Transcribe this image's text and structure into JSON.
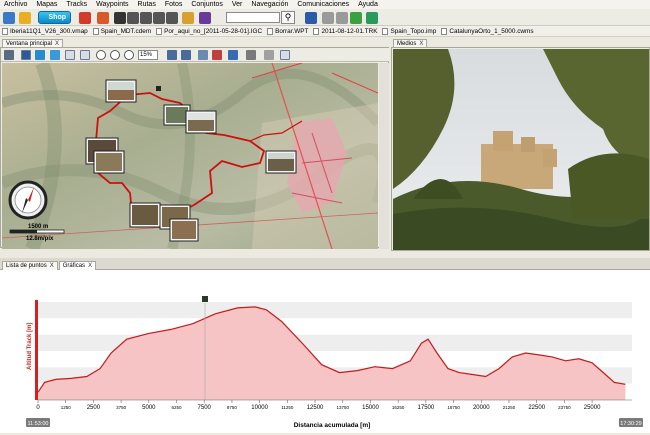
{
  "menu": [
    "Archivo",
    "Mapas",
    "Tracks",
    "Waypoints",
    "Rutas",
    "Fotos",
    "Conjuntos",
    "Ver",
    "Navegación",
    "Comunicaciones",
    "Ayuda"
  ],
  "toolbar": {
    "shop_label": "Shop",
    "search_icon": "magnifier-icon"
  },
  "files": [
    "Iberia11Q1_V26_300.vmap",
    "Spain_MDT.cdem",
    "Por_aqui_no_[2011-05-28-01].IGC",
    "Borrar.WPT",
    "2011-08-12-01.TRK",
    "Spain_Topo.imp",
    "CatalunyaOrto_1_5000.cwms"
  ],
  "map_panel": {
    "tab_label": "Ventana principal",
    "tab_close": "X",
    "zoom_value": "15%",
    "scale_distance": "1500 m",
    "scale_resolution": "12.8m/pix"
  },
  "media_panel": {
    "tab_label": "Medios",
    "tab_close": "X"
  },
  "bottom_tabs": [
    {
      "label": "Lista de puntos",
      "close": "X"
    },
    {
      "label": "Gráficas",
      "close": "X"
    }
  ],
  "colors": {
    "track": "#cc1010",
    "profile_fill": "#f6c4c4",
    "profile_line": "#c41a1a",
    "shop_button": "#1aa0dc"
  },
  "chart_data": {
    "type": "area",
    "xlabel": "Distancia acumulada [m]",
    "ylabel": "Altitud Track [m]",
    "xlim": [
      0,
      26800
    ],
    "x_ticks": [
      0,
      1250,
      2500,
      3750,
      5000,
      6250,
      7500,
      8750,
      10000,
      11250,
      12500,
      13750,
      15000,
      16250,
      17500,
      18750,
      20000,
      21250,
      22500,
      23750,
      25000
    ],
    "x_tick_labels": [
      "0",
      "1250",
      "2500",
      "3750",
      "5000",
      "6250",
      "7500",
      "8750",
      "10000",
      "11250",
      "12500",
      "13750",
      "15000",
      "16250",
      "17500",
      "18750",
      "20000",
      "21250",
      "22500",
      "23750",
      "25000"
    ],
    "start_time": "11:53:00",
    "end_time": "17:30:29",
    "grid": true,
    "series": [
      {
        "x": [
          0,
          300,
          800,
          1500,
          2200,
          2800,
          3300,
          4000,
          5000,
          6000,
          7000,
          8000,
          9000,
          9800,
          10300,
          11000,
          12000,
          12800,
          13600,
          14400,
          15200,
          16000,
          16800,
          17300,
          17600,
          18000,
          18500,
          19000,
          19600,
          20200,
          20800,
          21400,
          22000,
          22600,
          23200,
          23800,
          24400,
          25000,
          25600,
          26000,
          26500
        ],
        "y": [
          0.08,
          0.18,
          0.21,
          0.22,
          0.24,
          0.32,
          0.48,
          0.62,
          0.68,
          0.72,
          0.78,
          0.88,
          0.94,
          0.95,
          0.92,
          0.8,
          0.56,
          0.36,
          0.28,
          0.3,
          0.34,
          0.32,
          0.4,
          0.58,
          0.62,
          0.48,
          0.32,
          0.28,
          0.26,
          0.24,
          0.32,
          0.44,
          0.48,
          0.46,
          0.44,
          0.4,
          0.42,
          0.38,
          0.26,
          0.18,
          0.16
        ]
      }
    ]
  }
}
